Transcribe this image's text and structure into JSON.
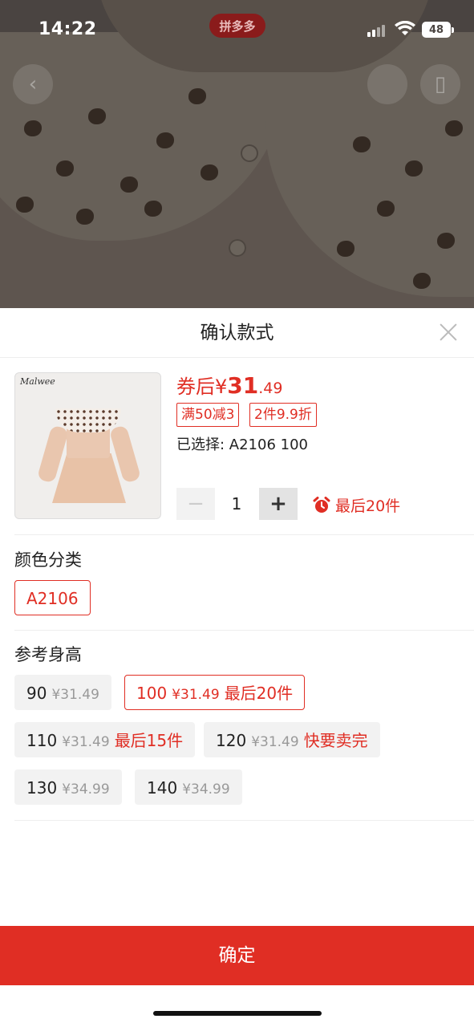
{
  "status_bar": {
    "time": "14:22",
    "app_badge": "拼多多",
    "battery": "48"
  },
  "sheet": {
    "title": "确认款式",
    "product": {
      "thumb_brand": "Malwee",
      "price_label": "券后",
      "price_currency": "¥",
      "price_int": "31",
      "price_dec": ".49",
      "promos": [
        "满50减3",
        "2件9.9折"
      ],
      "selected_text": "已选择: A2106 100",
      "quantity": "1",
      "stock_warning": "最后20件"
    },
    "color_section": {
      "title": "颜色分类",
      "options": [
        {
          "label": "A2106",
          "selected": true
        }
      ]
    },
    "size_section": {
      "title": "参考身高",
      "options": [
        {
          "size": "90",
          "price_int": "¥31",
          "price_dec": ".49",
          "tag": "",
          "selected": false
        },
        {
          "size": "100",
          "price_int": "¥31",
          "price_dec": ".49",
          "tag": "最后20件",
          "selected": true
        },
        {
          "size": "110",
          "price_int": "¥31",
          "price_dec": ".49",
          "tag": "最后15件",
          "selected": false
        },
        {
          "size": "120",
          "price_int": "¥31",
          "price_dec": ".49",
          "tag": "快要卖完",
          "selected": false
        },
        {
          "size": "130",
          "price_int": "¥34",
          "price_dec": ".99",
          "tag": "",
          "selected": false
        },
        {
          "size": "140",
          "price_int": "¥34",
          "price_dec": ".99",
          "tag": "",
          "selected": false
        }
      ]
    },
    "confirm_label": "确定"
  },
  "colors": {
    "accent": "#e02e24"
  }
}
